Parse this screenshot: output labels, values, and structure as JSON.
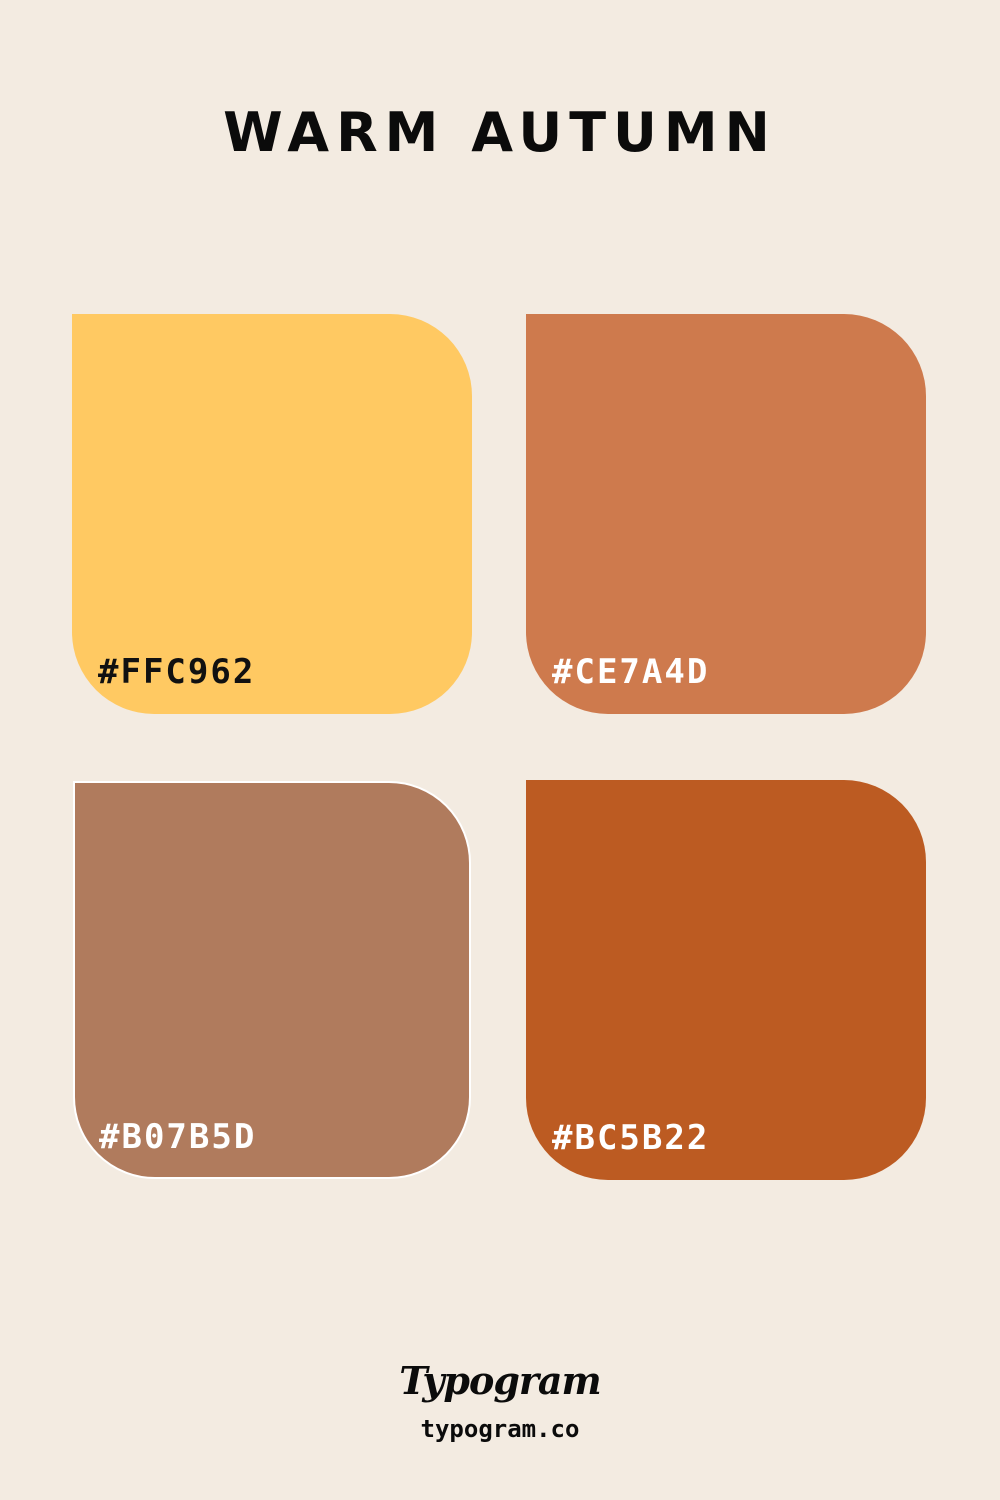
{
  "title": "WARM AUTUMN",
  "palette": [
    {
      "hex_label": "#FFC962",
      "color": "#FFC962",
      "text_color": "#111111"
    },
    {
      "hex_label": "#CE7A4D",
      "color": "#CE7A4D",
      "text_color": "#FFFFFF"
    },
    {
      "hex_label": "#B07B5D",
      "color": "#B07B5D",
      "text_color": "#FFFFFF"
    },
    {
      "hex_label": "#BC5B22",
      "color": "#BC5B22",
      "text_color": "#FFFFFF"
    }
  ],
  "footer": {
    "brand": "Typogram",
    "website": "typogram.co"
  },
  "background_color": "#F3EBE1"
}
